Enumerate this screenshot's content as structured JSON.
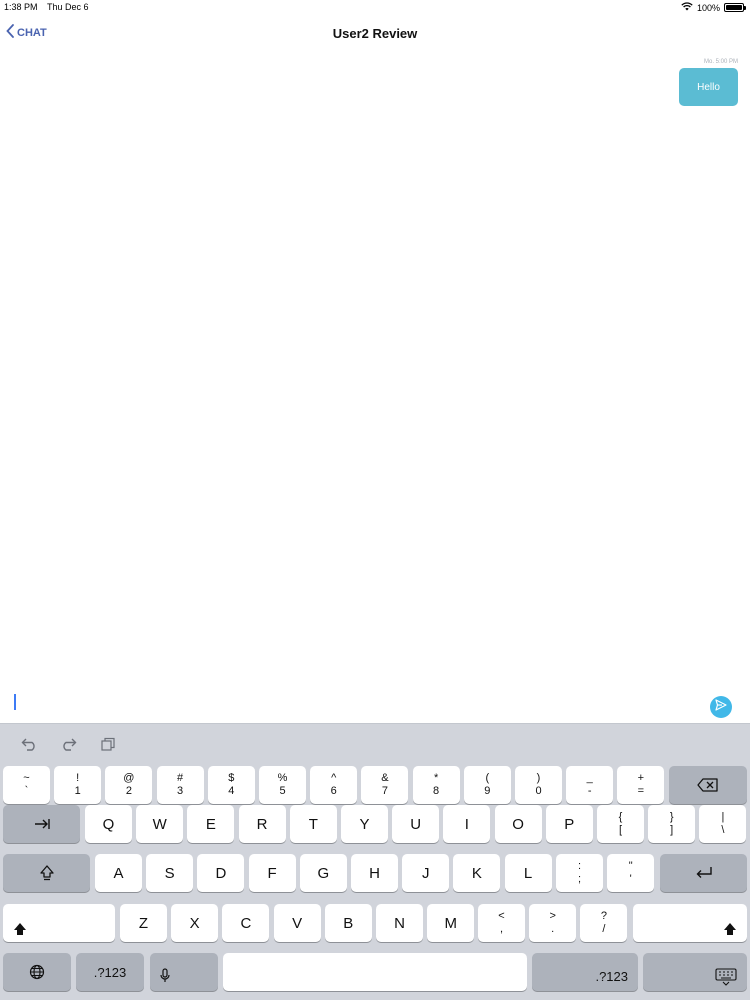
{
  "status_bar": {
    "time": "1:38 PM",
    "date": "Thu Dec 6",
    "battery_text": "100%",
    "battery_level": 1.0
  },
  "nav": {
    "back_label": "CHAT",
    "title": "User2 Review"
  },
  "messages": [
    {
      "timestamp": "Mo. 5:00 PM",
      "text": "Hello"
    }
  ],
  "colors": {
    "accent": "#4a63b0",
    "bubble": "#5bbcd3",
    "send": "#41b8e8",
    "keyboard_bg": "#d1d4db"
  },
  "keyboard": {
    "shortcut_icons": [
      "undo-icon",
      "redo-icon",
      "paste-icon"
    ],
    "row1": [
      [
        "~",
        "`"
      ],
      [
        "!",
        "1"
      ],
      [
        "@",
        "2"
      ],
      [
        "#",
        "3"
      ],
      [
        "$",
        "4"
      ],
      [
        "%",
        "5"
      ],
      [
        "^",
        "6"
      ],
      [
        "&",
        "7"
      ],
      [
        "*",
        "8"
      ],
      [
        "(",
        "9"
      ],
      [
        ")",
        "0"
      ],
      [
        "_",
        "-"
      ],
      [
        "+",
        "="
      ]
    ],
    "row2": [
      "Q",
      "W",
      "E",
      "R",
      "T",
      "Y",
      "U",
      "I",
      "O",
      "P"
    ],
    "row2_symbols": [
      [
        "{",
        "["
      ],
      [
        "}",
        "]"
      ],
      [
        "|",
        "\\"
      ]
    ],
    "row3": [
      "A",
      "S",
      "D",
      "F",
      "G",
      "H",
      "J",
      "K",
      "L"
    ],
    "row3_symbols": [
      [
        ":",
        ";"
      ],
      [
        "\"",
        "'"
      ]
    ],
    "row4": [
      "Z",
      "X",
      "C",
      "V",
      "B",
      "N",
      "M"
    ],
    "row4_symbols": [
      [
        "<",
        ","
      ],
      [
        ">",
        "."
      ],
      [
        "?",
        "/"
      ]
    ],
    "numeric_label": ".?123"
  }
}
